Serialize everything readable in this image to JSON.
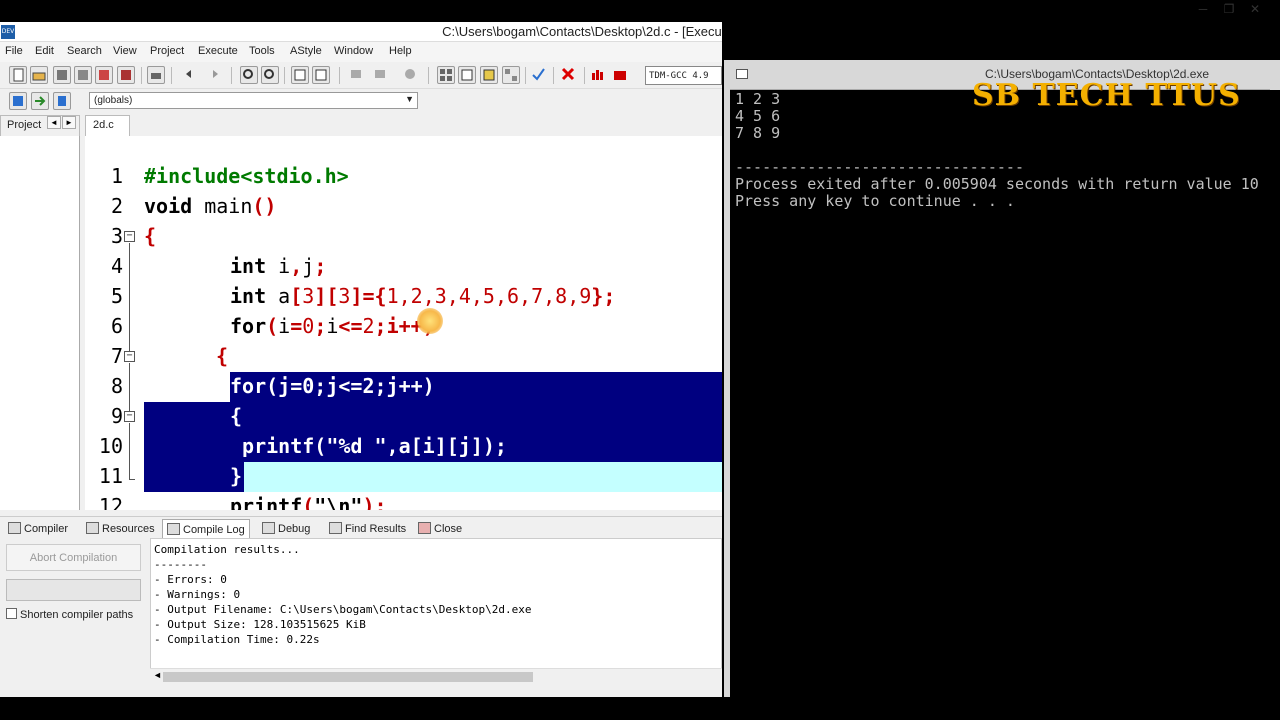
{
  "window_title": "C:\\Users\\bogam\\Contacts\\Desktop\\2d.c - [Executing] - Dev-C++ 5.11",
  "window_controls": [
    "─",
    "❐",
    "✕"
  ],
  "menu": [
    "File",
    "Edit",
    "Search",
    "View",
    "Project",
    "Execute",
    "Tools",
    "AStyle",
    "Window",
    "Help"
  ],
  "compiler_select": "TDM-GCC 4.9",
  "scope_select": "(globals)",
  "tabs": {
    "project": "Project",
    "file": "2d.c"
  },
  "code_lines": [
    {
      "n": "1"
    },
    {
      "n": "2"
    },
    {
      "n": "3"
    },
    {
      "n": "4"
    },
    {
      "n": "5"
    },
    {
      "n": "6"
    },
    {
      "n": "7"
    },
    {
      "n": "8"
    },
    {
      "n": "9"
    },
    {
      "n": "10"
    },
    {
      "n": "11"
    },
    {
      "n": "12"
    }
  ],
  "code": {
    "l1": "#include<stdio.h>",
    "l2_kw": "void",
    "l2_rest": " main",
    "l2_par": "()",
    "l3": "{",
    "l4_kw": "int",
    "l4_rest": " i",
    "l4_c": ",",
    "l4_j": "j",
    "l4_semi": ";",
    "l5_kw": "int",
    "l5_a": " a",
    "l5_b1": "[",
    "l5_n1": "3",
    "l5_b2": "][",
    "l5_n2": "3",
    "l5_b3": "]={",
    "l5_nums": "1,2,3,4,5,6,7,8,9",
    "l5_end": "};",
    "l6_kw": "for",
    "l6_p1": "(",
    "l6_i": "i",
    "l6_eq": "=",
    "l6_0": "0",
    "l6_s1": ";",
    "l6_i2": "i",
    "l6_le": "<=",
    "l6_2": "2",
    "l6_s2": ";",
    "l6_inc": "i++",
    "l6_p2": ")",
    "l7": "{",
    "l8": "for(j=0;j<=2;j++)",
    "l9": "{",
    "l10": " printf(\"%d \",a[i][j]);",
    "l11": "}",
    "l12_kw": "printf",
    "l12_p1": "(",
    "l12_str": "\"\\n\"",
    "l12_end": ");"
  },
  "bottom_tabs": [
    "Compiler",
    "Resources",
    "Compile Log",
    "Debug",
    "Find Results",
    "Close"
  ],
  "active_bottom_tab": "Compile Log",
  "abort_button": "Abort Compilation",
  "shorten_label": "Shorten compiler paths",
  "compile_log": [
    "Compilation results...",
    "--------",
    "- Errors: 0",
    "- Warnings: 0",
    "- Output Filename: C:\\Users\\bogam\\Contacts\\Desktop\\2d.exe",
    "- Output Size: 128.103515625 KiB",
    "- Compilation Time: 0.22s"
  ],
  "console": {
    "title": "C:\\Users\\bogam\\Contacts\\Desktop\\2d.exe",
    "lines": [
      "1 2 3",
      "4 5 6",
      "7 8 9",
      "",
      "--------------------------------",
      "Process exited after 0.005904 seconds with return value 10",
      "Press any key to continue . . ."
    ]
  },
  "watermark": "SB TECH TTUS",
  "colors": {
    "selection": "#000080",
    "current_line": "#c4ffff",
    "watermark": "#f4b000"
  }
}
